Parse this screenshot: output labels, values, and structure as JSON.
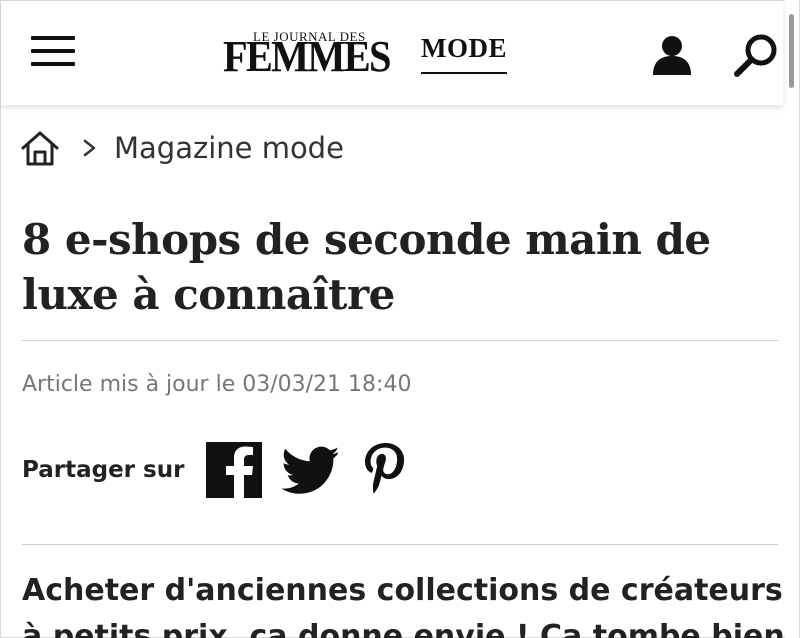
{
  "header": {
    "logo_small": "LE JOURNAL DES",
    "logo_big": "FEMMES",
    "section_label": "MODE",
    "icons": [
      "menu-icon",
      "user-icon",
      "search-icon"
    ]
  },
  "breadcrumb": {
    "home_icon": "home-icon",
    "separator": ">",
    "link": "Magazine mode"
  },
  "article": {
    "title": "8 e-shops de seconde main de luxe à connaître",
    "updated": "Article mis à jour le 03/03/21 18:40",
    "share_label": "Partager sur",
    "share_icons": [
      "facebook-icon",
      "twitter-icon",
      "pinterest-icon"
    ],
    "lead_line1": "Acheter d'anciennes collections de créateurs",
    "lead_line2": "à petits prix, ça donne envie ! Ça tombe bien"
  },
  "colors": {
    "text": "#222222",
    "muted": "#777777",
    "rule": "#cfcfcf"
  }
}
